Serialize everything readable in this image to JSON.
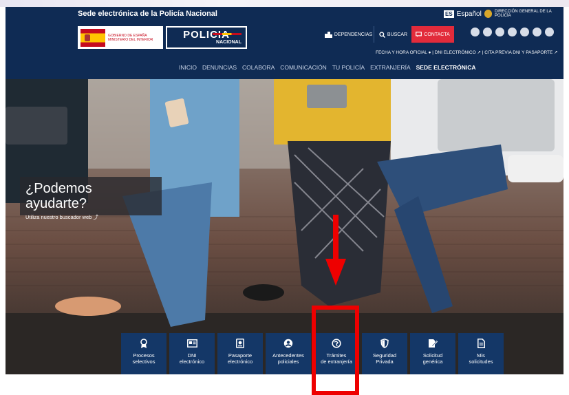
{
  "header": {
    "site_title": "Sede electrónica de la Policía Nacional",
    "lang_code": "ES",
    "language": "Español",
    "direction": "DIRECCIÓN GENERAL DE LA POLICÍA",
    "gov_line1": "GOBIERNO DE ESPAÑA",
    "gov_line2": "MINISTERIO DEL INTERIOR",
    "logo_main": "POLICIA",
    "logo_sub": "NACIONAL",
    "btn_dependencias": "DEPENDENCIAS",
    "btn_buscar": "BUSCAR",
    "btn_contacta": "CONTACTA",
    "social_icons": [
      "twitter-icon",
      "facebook-icon",
      "youtube-icon",
      "instagram-icon",
      "telegram-icon",
      "tiktok-icon",
      "other-icon"
    ],
    "utility": {
      "fecha": "FECHA Y HORA OFICIAL",
      "dni": "DNI ELECTRÓNICO",
      "cita": "CITA PREVIA DNI Y PASAPORTE"
    },
    "nav": [
      "INICIO",
      "DENUNCIAS",
      "COLABORA",
      "COMUNICACIÓN",
      "TU POLICÍA",
      "EXTRANJERÍA",
      "SEDE ELECTRÓNICA"
    ]
  },
  "hero": {
    "question": "¿Podemos ayudarte?",
    "subtitle": "Utiliza nuestro buscador web"
  },
  "tiles": [
    {
      "l1": "Procesos",
      "l2": "selectivos",
      "icon": "medal-icon"
    },
    {
      "l1": "DNI",
      "l2": "electrónico",
      "icon": "id-card-icon"
    },
    {
      "l1": "Pasaporte",
      "l2": "electrónico",
      "icon": "passport-icon"
    },
    {
      "l1": "Antecedentes",
      "l2": "policiales",
      "icon": "user-circle-icon"
    },
    {
      "l1": "Trámites",
      "l2": "de extranjería",
      "icon": "globe-icon"
    },
    {
      "l1": "Seguridad",
      "l2": "Privada",
      "icon": "shield-icon"
    },
    {
      "l1": "Solicitud",
      "l2": "genérica",
      "icon": "edit-doc-icon"
    },
    {
      "l1": "Mis",
      "l2": "solicitudes",
      "icon": "document-icon"
    }
  ],
  "colors": {
    "navy": "#0f2b54",
    "tile": "#143767",
    "contacta": "#e22b3b",
    "annotation": "#ee0000"
  }
}
